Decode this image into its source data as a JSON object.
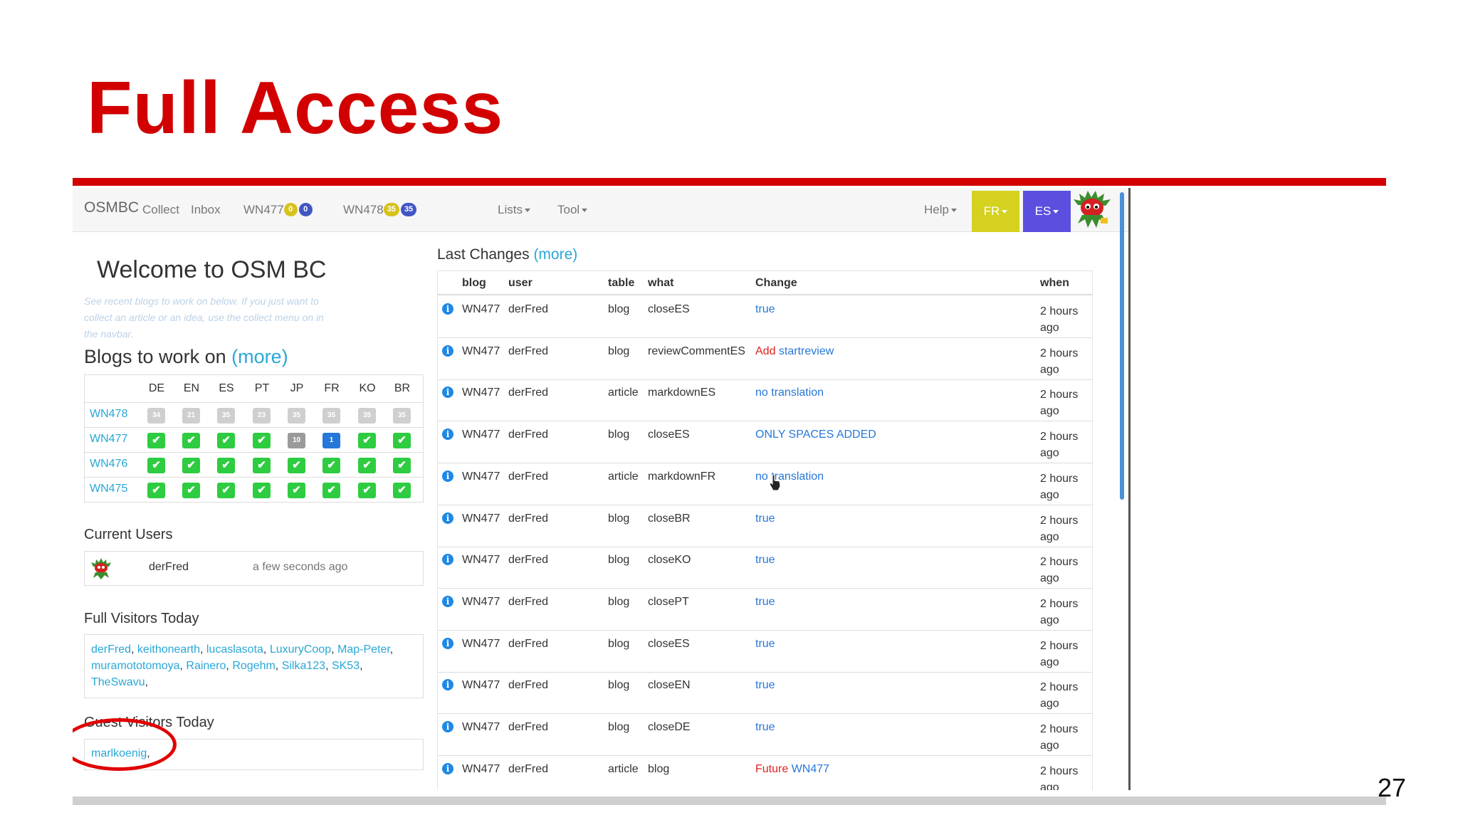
{
  "slide": {
    "title": "Full Access",
    "page_number": "27"
  },
  "navbar": {
    "brand": "OSMBC",
    "items": [
      {
        "label": "Collect"
      },
      {
        "label": "Inbox"
      },
      {
        "label": "WN477",
        "badges": [
          "0",
          "0"
        ]
      },
      {
        "label": "WN478",
        "badges": [
          "35",
          "35"
        ]
      },
      {
        "label": "Lists"
      },
      {
        "label": "Tool"
      },
      {
        "label": "Help"
      }
    ],
    "lang_buttons": [
      {
        "label": "FR",
        "color": "#d4d21e"
      },
      {
        "label": "ES",
        "color": "#5b4fe0"
      }
    ]
  },
  "left": {
    "welcome": "Welcome to OSM BC",
    "intro": "See recent blogs to work on below. If you just want to collect an article or an idea, use the collect menu on in the navbar.",
    "blogs_heading": "Blogs to work on",
    "more": "(more)",
    "languages": [
      "DE",
      "EN",
      "ES",
      "PT",
      "JP",
      "FR",
      "KO",
      "BR"
    ],
    "blogs": [
      {
        "name": "WN478",
        "cells": [
          {
            "v": "34",
            "s": "grey"
          },
          {
            "v": "21",
            "s": "grey"
          },
          {
            "v": "35",
            "s": "grey"
          },
          {
            "v": "23",
            "s": "grey"
          },
          {
            "v": "35",
            "s": "grey"
          },
          {
            "v": "35",
            "s": "grey"
          },
          {
            "v": "35",
            "s": "grey"
          },
          {
            "v": "35",
            "s": "grey"
          }
        ]
      },
      {
        "name": "WN477",
        "cells": [
          {
            "v": "✔",
            "s": "done"
          },
          {
            "v": "✔",
            "s": "done"
          },
          {
            "v": "✔",
            "s": "done"
          },
          {
            "v": "✔",
            "s": "done"
          },
          {
            "v": "10",
            "s": "dark"
          },
          {
            "v": "1",
            "s": "blue"
          },
          {
            "v": "✔",
            "s": "done"
          },
          {
            "v": "✔",
            "s": "done"
          }
        ]
      },
      {
        "name": "WN476",
        "cells": [
          {
            "v": "✔",
            "s": "done"
          },
          {
            "v": "✔",
            "s": "done"
          },
          {
            "v": "✔",
            "s": "done"
          },
          {
            "v": "✔",
            "s": "done"
          },
          {
            "v": "✔",
            "s": "done"
          },
          {
            "v": "✔",
            "s": "done"
          },
          {
            "v": "✔",
            "s": "done"
          },
          {
            "v": "✔",
            "s": "done"
          }
        ]
      },
      {
        "name": "WN475",
        "cells": [
          {
            "v": "✔",
            "s": "done"
          },
          {
            "v": "✔",
            "s": "done"
          },
          {
            "v": "✔",
            "s": "done"
          },
          {
            "v": "✔",
            "s": "done"
          },
          {
            "v": "✔",
            "s": "done"
          },
          {
            "v": "✔",
            "s": "done"
          },
          {
            "v": "✔",
            "s": "done"
          },
          {
            "v": "✔",
            "s": "done"
          }
        ]
      }
    ],
    "current_users_heading": "Current Users",
    "current_user": {
      "name": "derFred",
      "when": "a few seconds ago"
    },
    "full_visitors_heading": "Full Visitors Today",
    "full_visitors": [
      "derFred",
      "keithonearth",
      "lucaslasota",
      "LuxuryCoop",
      "Map-Peter",
      "muramototomoya",
      "Rainero",
      "Rogehm",
      "Silka123",
      "SK53",
      "TheSwavu"
    ],
    "guest_visitors_heading": "Guest Visitors Today",
    "guest_visitors": [
      "marlkoenig"
    ]
  },
  "changes": {
    "heading": "Last Changes",
    "more": "(more)",
    "columns": [
      "blog",
      "user",
      "table",
      "what",
      "Change",
      "when"
    ],
    "rows": [
      {
        "blog": "WN477",
        "user": "derFred",
        "table": "blog",
        "what": "closeES",
        "change": [
          {
            "t": "true",
            "c": "blue"
          }
        ],
        "when": [
          "2 hours",
          "ago"
        ]
      },
      {
        "blog": "WN477",
        "user": "derFred",
        "table": "blog",
        "what": "reviewCommentES",
        "change": [
          {
            "t": "Add",
            "c": "red"
          },
          {
            "t": " startreview",
            "c": "blue"
          }
        ],
        "when": [
          "2 hours",
          "ago"
        ]
      },
      {
        "blog": "WN477",
        "user": "derFred",
        "table": "article",
        "what": "markdownES",
        "change": [
          {
            "t": "no translation",
            "c": "blue"
          }
        ],
        "when": [
          "2 hours",
          "ago"
        ]
      },
      {
        "blog": "WN477",
        "user": "derFred",
        "table": "blog",
        "what": "closeES",
        "change": [
          {
            "t": "ONLY SPACES ADDED",
            "c": "blue"
          }
        ],
        "when": [
          "2 hours",
          "ago"
        ]
      },
      {
        "blog": "WN477",
        "user": "derFred",
        "table": "article",
        "what": "markdownFR",
        "change": [
          {
            "t": "no translation",
            "c": "blue"
          }
        ],
        "when": [
          "2 hours",
          "ago"
        ]
      },
      {
        "blog": "WN477",
        "user": "derFred",
        "table": "blog",
        "what": "closeBR",
        "change": [
          {
            "t": "true",
            "c": "blue"
          }
        ],
        "when": [
          "2 hours",
          "ago"
        ]
      },
      {
        "blog": "WN477",
        "user": "derFred",
        "table": "blog",
        "what": "closeKO",
        "change": [
          {
            "t": "true",
            "c": "blue"
          }
        ],
        "when": [
          "2 hours",
          "ago"
        ]
      },
      {
        "blog": "WN477",
        "user": "derFred",
        "table": "blog",
        "what": "closePT",
        "change": [
          {
            "t": "true",
            "c": "blue"
          }
        ],
        "when": [
          "2 hours",
          "ago"
        ]
      },
      {
        "blog": "WN477",
        "user": "derFred",
        "table": "blog",
        "what": "closeES",
        "change": [
          {
            "t": "true",
            "c": "blue"
          }
        ],
        "when": [
          "2 hours",
          "ago"
        ]
      },
      {
        "blog": "WN477",
        "user": "derFred",
        "table": "blog",
        "what": "closeEN",
        "change": [
          {
            "t": "true",
            "c": "blue"
          }
        ],
        "when": [
          "2 hours",
          "ago"
        ]
      },
      {
        "blog": "WN477",
        "user": "derFred",
        "table": "blog",
        "what": "closeDE",
        "change": [
          {
            "t": "true",
            "c": "blue"
          }
        ],
        "when": [
          "2 hours",
          "ago"
        ]
      },
      {
        "blog": "WN477",
        "user": "derFred",
        "table": "article",
        "what": "blog",
        "change": [
          {
            "t": "Future",
            "c": "red"
          },
          {
            "t": " WN477",
            "c": "blue"
          }
        ],
        "when": [
          "2 hours",
          "ago"
        ]
      }
    ]
  }
}
